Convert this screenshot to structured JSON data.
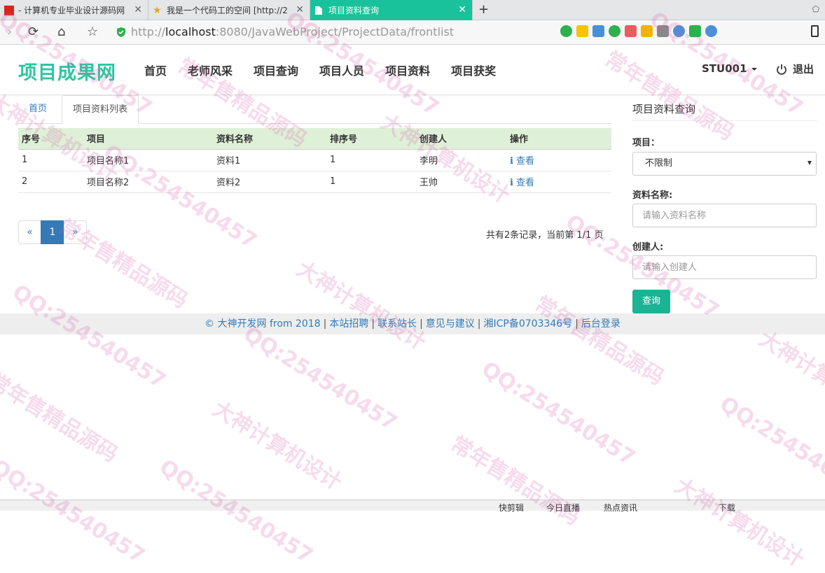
{
  "browser": {
    "tabs": [
      {
        "title": "- 计算机专业毕业设计源码网",
        "active": false
      },
      {
        "title": "我是一个代码工的空间 [http://2",
        "active": false
      },
      {
        "title": "项目资料查询",
        "active": true
      }
    ],
    "new_tab": "+",
    "url_prefix": "http://",
    "url_host": "localhost",
    "url_rest": ":8080/JavaWebProject/ProjectData/frontlist"
  },
  "site": {
    "brand": "项目成果网",
    "nav": [
      "首页",
      "老师风采",
      "项目查询",
      "项目人员",
      "项目资料",
      "项目获奖"
    ],
    "user": "STU001",
    "logout": "退出"
  },
  "breadcrumb": {
    "home": "首页",
    "current": "项目资料列表"
  },
  "table": {
    "headers": [
      "序号",
      "项目",
      "资料名称",
      "排序号",
      "创建人",
      "操作"
    ],
    "rows": [
      {
        "no": "1",
        "project": "项目名称1",
        "name": "资料1",
        "order": "1",
        "creator": "李明",
        "action": "查看"
      },
      {
        "no": "2",
        "project": "项目名称2",
        "name": "资料2",
        "order": "1",
        "creator": "王帅",
        "action": "查看"
      }
    ],
    "action_icon": "info-icon"
  },
  "pagination": {
    "prev": "«",
    "current_page": "1",
    "next": "»",
    "info": "共有2条记录，当前第 1/1 页"
  },
  "search_panel": {
    "title": "项目资料查询",
    "project_label": "项目：",
    "project_value": "不限制",
    "name_label": "资料名称:",
    "name_placeholder": "请输入资料名称",
    "creator_label": "创建人:",
    "creator_placeholder": "请输入创建人",
    "submit": "查询"
  },
  "footer": {
    "links": [
      "© 大神开发网 from 2018",
      "本站招聘",
      "联系站长",
      "意见与建议",
      "湘ICP备0703346号",
      "后台登录"
    ]
  },
  "statusbar": {
    "items": [
      "快剪辑",
      "今日直播",
      "热点资讯",
      "下载"
    ]
  },
  "watermarks": [
    "大神计算机设计",
    "QQ:254540457",
    "常年售精品源码"
  ],
  "colors": {
    "brand": "#2ec5a0",
    "active_tab": "#19c29a",
    "table_header": "#dff0d8",
    "link": "#337ab7",
    "button": "#1ab394",
    "pager_active": "#337ab7"
  }
}
